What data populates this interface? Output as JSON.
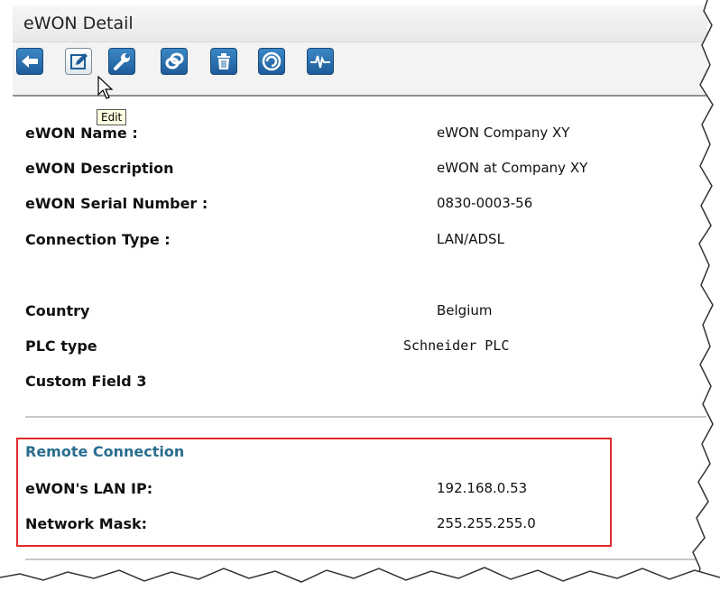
{
  "window": {
    "title": "eWON Detail"
  },
  "toolbar": {
    "buttons": [
      {
        "icon": "back-arrow-icon"
      },
      {
        "icon": "edit-icon"
      },
      {
        "icon": "wrench-icon"
      },
      {
        "icon": "connect-icon"
      },
      {
        "icon": "trash-icon"
      },
      {
        "icon": "ewon-logo-icon"
      },
      {
        "icon": "signal-wave-icon"
      }
    ],
    "tooltip": "Edit"
  },
  "details": [
    {
      "label": "eWON Name :",
      "value": "eWON Company XY"
    },
    {
      "label": "eWON Description",
      "value": "eWON at Company XY"
    },
    {
      "label": "eWON Serial Number :",
      "value": "0830-0003-56"
    },
    {
      "label": "Connection Type :",
      "value": "LAN/ADSL"
    },
    {
      "label": "Country",
      "value": "Belgium"
    },
    {
      "label": "PLC type",
      "value": "Schneider PLC"
    },
    {
      "label": "Custom Field 3",
      "value": ""
    }
  ],
  "remote_connection": {
    "title": "Remote Connection",
    "rows": [
      {
        "label": "eWON's LAN IP:",
        "value": "192.168.0.53"
      },
      {
        "label": "Network Mask:",
        "value": "255.255.255.0"
      }
    ]
  },
  "colors": {
    "toolbar_button": "#2a6fae",
    "section_title": "#2a6d8e",
    "highlight_border": "#e02a2a"
  }
}
